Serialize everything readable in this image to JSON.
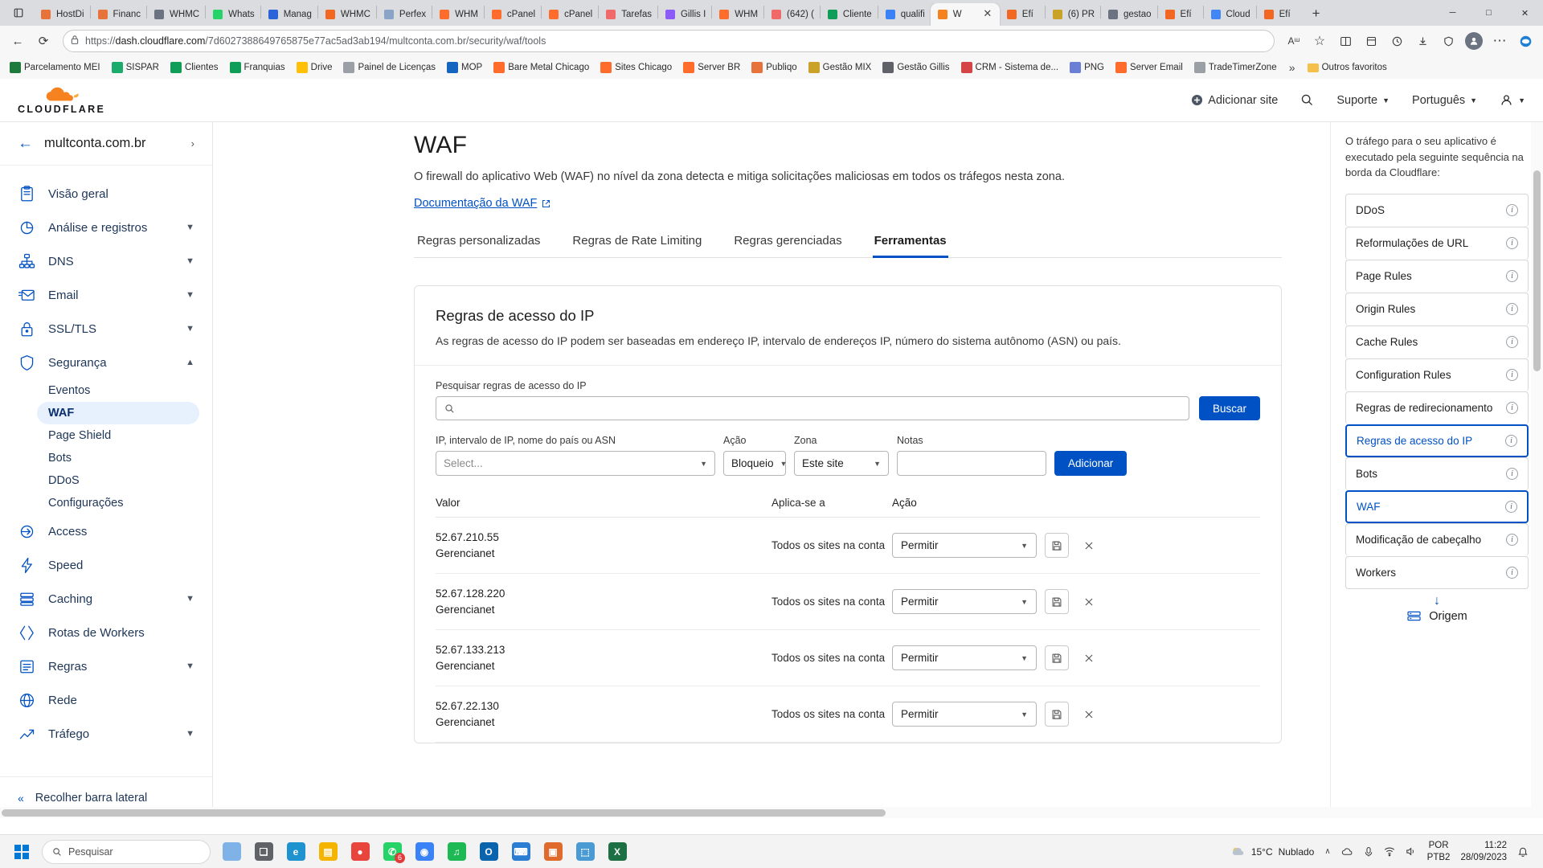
{
  "browser": {
    "tabs": [
      {
        "title": "HostDi",
        "icon": "hostdime-icon",
        "color": "#e8733a",
        "active": false
      },
      {
        "title": "Financ",
        "icon": "finance-icon",
        "color": "#e8733a",
        "active": false
      },
      {
        "title": "WHMC",
        "icon": "document-icon",
        "color": "#6b7280",
        "active": false
      },
      {
        "title": "Whats",
        "icon": "whatsapp-icon",
        "color": "#25d366",
        "active": false
      },
      {
        "title": "Manag",
        "icon": "vultr-icon",
        "color": "#2b63d9",
        "active": false
      },
      {
        "title": "WHMC",
        "icon": "whmcs-icon",
        "color": "#f26722",
        "active": false
      },
      {
        "title": "Perfex",
        "icon": "perfex-icon",
        "color": "#8aa4c8",
        "active": false
      },
      {
        "title": "WHM",
        "icon": "cpanel-icon",
        "color": "#ff6c2c",
        "active": false
      },
      {
        "title": "cPanel",
        "icon": "cpanel-icon",
        "color": "#ff6c2c",
        "active": false
      },
      {
        "title": "cPanel",
        "icon": "cpanel-icon",
        "color": "#ff6c2c",
        "active": false
      },
      {
        "title": "Tarefas",
        "icon": "asana-icon",
        "color": "#f06a6a",
        "active": false
      },
      {
        "title": "Gillis I",
        "icon": "asana-icon",
        "color": "#8b5cf6",
        "active": false
      },
      {
        "title": "WHM",
        "icon": "cpanel-icon",
        "color": "#ff6c2c",
        "active": false
      },
      {
        "title": "(642) (",
        "icon": "asana-icon",
        "color": "#f06a6a",
        "active": false
      },
      {
        "title": "Cliente",
        "icon": "sheets-icon",
        "color": "#0f9d58",
        "active": false
      },
      {
        "title": "qualifi",
        "icon": "globe-icon",
        "color": "#3b82f6",
        "active": false
      },
      {
        "title": "W",
        "icon": "cloudflare-icon",
        "color": "#f6821f",
        "active": true
      },
      {
        "title": "Efí",
        "icon": "efi-icon",
        "color": "#f26722",
        "active": false
      },
      {
        "title": "(6) PR",
        "icon": "monday-icon",
        "color": "#c9a227",
        "active": false
      },
      {
        "title": "gestao",
        "icon": "document-icon",
        "color": "#6b7280",
        "active": false
      },
      {
        "title": "Efí",
        "icon": "efi-icon",
        "color": "#f26722",
        "active": false
      },
      {
        "title": "Cloud",
        "icon": "google-icon",
        "color": "#4285f4",
        "active": false
      },
      {
        "title": "Efí",
        "icon": "efi-icon",
        "color": "#f26722",
        "active": false
      }
    ],
    "new_tab_label": "+",
    "window_controls": {
      "minimize": "─",
      "maximize": "□",
      "close": "✕"
    },
    "url_prefix": "https://",
    "url_domain": "dash.cloudflare.com",
    "url_path": "/7d6027388649765875e77ac5ad3ab194/multconta.com.br/security/waf/tools",
    "nav": {
      "back": "←",
      "reload": "⟳",
      "lock": "lock-icon"
    },
    "actions": {
      "read_aloud": "Aᵚ",
      "favorite": "☆",
      "split": "split-screen-icon",
      "collections": "collections-icon",
      "history": "history-icon",
      "downloads": "downloads-icon",
      "browser_essentials": "essentials-icon",
      "profile": "profile-icon",
      "settings": "⋯",
      "copilot": "copilot-icon"
    },
    "bookmarks": [
      {
        "label": "Parcelamento MEI",
        "icon": "gov-icon",
        "color": "#1e7a3c"
      },
      {
        "label": "SISPAR",
        "icon": "drive-icon",
        "color": "#1bab6b"
      },
      {
        "label": "Clientes",
        "icon": "sheets-icon",
        "color": "#0f9d58"
      },
      {
        "label": "Franquias",
        "icon": "sheets-icon",
        "color": "#0f9d58"
      },
      {
        "label": "Drive",
        "icon": "drive-icon",
        "color": "#ffc107"
      },
      {
        "label": "Painel de Licenças",
        "icon": "document-icon",
        "color": "#9aa0a6"
      },
      {
        "label": "MOP",
        "icon": "mop-icon",
        "color": "#1565c0"
      },
      {
        "label": "Bare Metal Chicago",
        "icon": "cpanel-icon",
        "color": "#ff6c2c"
      },
      {
        "label": "Sites Chicago",
        "icon": "cpanel-icon",
        "color": "#ff6c2c"
      },
      {
        "label": "Server BR",
        "icon": "cpanel-icon",
        "color": "#ff6c2c"
      },
      {
        "label": "Publiqo",
        "icon": "publiqo-icon",
        "color": "#e8733a"
      },
      {
        "label": "Gestão MIX",
        "icon": "monday-icon",
        "color": "#c9a227"
      },
      {
        "label": "Gestão Gillis",
        "icon": "gear-icon",
        "color": "#5f6368"
      },
      {
        "label": "CRM - Sistema de...",
        "icon": "crm-icon",
        "color": "#d64545"
      },
      {
        "label": "PNG",
        "icon": "png-icon",
        "color": "#6b7fd7"
      },
      {
        "label": "Server Email",
        "icon": "cpanel-icon",
        "color": "#ff6c2c"
      },
      {
        "label": "TradeTimerZone",
        "icon": "document-icon",
        "color": "#9aa0a6"
      }
    ],
    "bookmarks_overflow": "»",
    "other_favorites": "Outros favoritos"
  },
  "cloudflare": {
    "brand": "CLOUDFLARE",
    "topbar": {
      "add_site": "Adicionar site",
      "search_icon": "search-icon",
      "support": "Suporte",
      "language": "Português",
      "account_icon": "user-icon"
    },
    "sidebar": {
      "back_icon": "arrow-left-icon",
      "zone": "multconta.com.br",
      "zone_caret": "›",
      "items": [
        {
          "label": "Visão geral",
          "icon": "clipboard-icon",
          "caret": false
        },
        {
          "label": "Análise e registros",
          "icon": "analytics-icon",
          "caret": true
        },
        {
          "label": "DNS",
          "icon": "dns-icon",
          "caret": true
        },
        {
          "label": "Email",
          "icon": "email-icon",
          "caret": true
        },
        {
          "label": "SSL/TLS",
          "icon": "lock-icon",
          "caret": true
        },
        {
          "label": "Segurança",
          "icon": "shield-icon",
          "caret": true,
          "expanded": true
        }
      ],
      "security_children": [
        {
          "label": "Eventos",
          "active": false
        },
        {
          "label": "WAF",
          "active": true
        },
        {
          "label": "Page Shield",
          "active": false
        },
        {
          "label": "Bots",
          "active": false
        },
        {
          "label": "DDoS",
          "active": false
        },
        {
          "label": "Configurações",
          "active": false
        }
      ],
      "items_after": [
        {
          "label": "Access",
          "icon": "access-icon",
          "caret": false
        },
        {
          "label": "Speed",
          "icon": "speed-icon",
          "caret": false
        },
        {
          "label": "Caching",
          "icon": "caching-icon",
          "caret": true
        },
        {
          "label": "Rotas de Workers",
          "icon": "workers-icon",
          "caret": false
        },
        {
          "label": "Regras",
          "icon": "rules-icon",
          "caret": true
        },
        {
          "label": "Rede",
          "icon": "network-icon",
          "caret": false
        },
        {
          "label": "Tráfego",
          "icon": "traffic-icon",
          "caret": true
        }
      ],
      "collapse": "Recolher barra lateral",
      "collapse_icon": "chevron-double-left-icon"
    },
    "main": {
      "title": "WAF",
      "description": "O firewall do aplicativo Web (WAF) no nível da zona detecta e mitiga solicitações maliciosas em todos os tráfegos nesta zona.",
      "doc_link": "Documentação da WAF",
      "doc_link_icon": "external-link-icon",
      "tabs": [
        {
          "label": "Regras personalizadas",
          "active": false
        },
        {
          "label": "Regras de Rate Limiting",
          "active": false
        },
        {
          "label": "Regras gerenciadas",
          "active": false
        },
        {
          "label": "Ferramentas",
          "active": true
        }
      ],
      "card": {
        "title": "Regras de acesso do IP",
        "subtitle": "As regras de acesso do IP podem ser baseadas em endereço IP, intervalo de endereços IP, número do sistema autônomo (ASN) ou país.",
        "search_label": "Pesquisar regras de acesso do IP",
        "search_value": "",
        "search_icon": "search-icon",
        "search_button": "Buscar",
        "form": {
          "ip_label": "IP, intervalo de IP, nome do país ou ASN",
          "ip_placeholder": "Select...",
          "action_label": "Ação",
          "action_value": "Bloqueio",
          "zone_label": "Zona",
          "zone_value": "Este site",
          "notes_label": "Notas",
          "notes_value": "",
          "add_button": "Adicionar"
        },
        "table": {
          "headers": [
            "Valor",
            "Aplica-se a",
            "Ação"
          ],
          "rows": [
            {
              "ip": "52.67.210.55",
              "note": "Gerencianet",
              "applies": "Todos os sites na conta",
              "action": "Permitir"
            },
            {
              "ip": "52.67.128.220",
              "note": "Gerencianet",
              "applies": "Todos os sites na conta",
              "action": "Permitir"
            },
            {
              "ip": "52.67.133.213",
              "note": "Gerencianet",
              "applies": "Todos os sites na conta",
              "action": "Permitir"
            },
            {
              "ip": "52.67.22.130",
              "note": "Gerencianet",
              "applies": "Todos os sites na conta",
              "action": "Permitir"
            }
          ],
          "save_icon": "save-icon",
          "delete_icon": "close-icon"
        }
      }
    },
    "right_panel": {
      "description": "O tráfego para o seu aplicativo é executado pela seguinte sequência na borda da Cloudflare:",
      "items": [
        {
          "label": "DDoS",
          "highlight": false
        },
        {
          "label": "Reformulações de URL",
          "highlight": false
        },
        {
          "label": "Page Rules",
          "highlight": false
        },
        {
          "label": "Origin Rules",
          "highlight": false
        },
        {
          "label": "Cache Rules",
          "highlight": false
        },
        {
          "label": "Configuration Rules",
          "highlight": false
        },
        {
          "label": "Regras de redirecionamento",
          "highlight": false
        },
        {
          "label": "Regras de acesso do IP",
          "highlight": true
        },
        {
          "label": "Bots",
          "highlight": false
        },
        {
          "label": "WAF",
          "highlight": true
        },
        {
          "label": "Modificação de cabeçalho",
          "highlight": false
        },
        {
          "label": "Workers",
          "highlight": false
        }
      ],
      "info_icon": "info-icon",
      "arrow": "↓",
      "origin_label": "Origem",
      "origin_icon": "server-icon"
    }
  },
  "taskbar": {
    "search_placeholder": "Pesquisar",
    "search_icon": "search-icon",
    "start_icon": "windows-icon",
    "apps": [
      {
        "name": "weather-widget",
        "label": "",
        "color": "#7fb3e8"
      },
      {
        "name": "task-view",
        "label": "❑",
        "color": "#5f6368"
      },
      {
        "name": "edge",
        "label": "e",
        "color": "#1f92d0"
      },
      {
        "name": "file-explorer",
        "label": "▤",
        "color": "#f5b400"
      },
      {
        "name": "chrome",
        "label": "●",
        "color": "#e8453c"
      },
      {
        "name": "whatsapp",
        "label": "✆",
        "color": "#25d366",
        "badge": "6"
      },
      {
        "name": "apps-group",
        "label": "◉",
        "color": "#3b82f6"
      },
      {
        "name": "spotify",
        "label": "♫",
        "color": "#1db954"
      },
      {
        "name": "outlook",
        "label": "O",
        "color": "#0a64ad"
      },
      {
        "name": "vscode",
        "label": "⌨",
        "color": "#2b7cd3"
      },
      {
        "name": "photos",
        "label": "▣",
        "color": "#e06a2b"
      },
      {
        "name": "terminal",
        "label": "⬚",
        "color": "#4a9bd4"
      },
      {
        "name": "excel",
        "label": "X",
        "color": "#1d7044"
      }
    ],
    "tray": {
      "weather_temp": "15°C",
      "weather_desc": "Nublado",
      "chevron": "∧",
      "onedrive_icon": "cloud-icon",
      "mic_icon": "mic-icon",
      "network_icon": "network-icon",
      "volume_icon": "volume-icon",
      "lang_line1": "POR",
      "lang_line2": "PTB2",
      "time": "11:22",
      "date": "28/09/2023",
      "notification_icon": "notification-icon"
    }
  }
}
